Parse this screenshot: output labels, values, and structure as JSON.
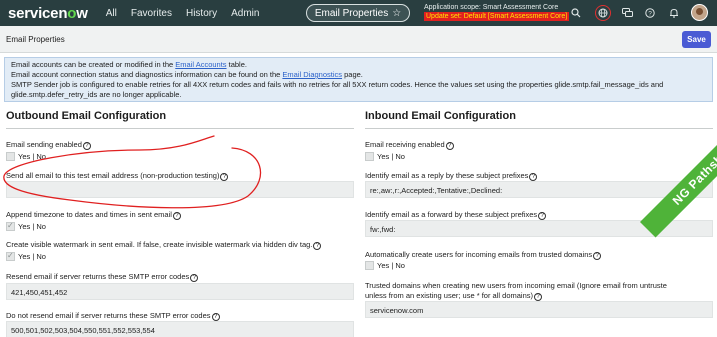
{
  "nav": {
    "brand_pre": "servicen",
    "brand_dot": "o",
    "brand_post": "w",
    "links": [
      "All",
      "Favorites",
      "History",
      "Admin"
    ],
    "pill_label": "Email Properties",
    "scope_line1": "Application scope: Smart Assessment Core",
    "scope_line2": "Update set: Default [Smart Assessment Core]",
    "icons": [
      "search-icon",
      "globe-icon",
      "chat-icon",
      "help-icon",
      "bell-icon",
      "avatar"
    ]
  },
  "form": {
    "title": "Email Properties",
    "save_label": "Save"
  },
  "info": {
    "line1_pre": "Email accounts can be created or modified in the ",
    "line1_link": "Email Accounts",
    "line1_post": " table.",
    "line2_pre": "Email account connection status and diagnostics information can be found on the ",
    "line2_link": "Email Diagnostics",
    "line2_post": " page.",
    "line3": "SMTP Sender job is configured to enable retries for all 4XX return codes and fails with no retries for all 5XX return codes. Hence the values set using the properties glide.smtp.fail_message_ids and",
    "line4": "glide.smtp.defer_retry_ids are no longer applicable."
  },
  "outbound": {
    "heading": "Outbound Email Configuration",
    "sending_label": "Email sending enabled",
    "sending_value": "Yes | No",
    "testaddr_label": "Send all email to this test email address (non-production testing)",
    "testaddr_value": "",
    "timezone_label": "Append timezone to dates and times in sent email",
    "timezone_value": "Yes | No",
    "watermark_label": "Create visible watermark in sent email. If false, create invisible watermark via hidden div tag.",
    "watermark_value": "Yes | No",
    "resend_label": "Resend email if server returns these SMTP error codes",
    "resend_value": "421,450,451,452",
    "noresend_label": "Do not resend email if server returns these SMTP error codes",
    "noresend_value": "500,501,502,503,504,550,551,552,553,554"
  },
  "inbound": {
    "heading": "Inbound Email Configuration",
    "receiving_label": "Email receiving enabled",
    "receiving_value": "Yes | No",
    "reply_label": "Identify email as a reply by these subject prefixes",
    "reply_value": "re:,aw:,r:,Accepted:,Tentative:,Declined:",
    "forward_label": "Identify email as a forward by these subject prefixes",
    "forward_value": "fw:,fwd:",
    "autocreate_label": "Automatically create users for incoming emails from trusted domains",
    "autocreate_value": "Yes | No",
    "trusted_label1": "Trusted domains when creating new users from incoming email (Ignore email from untruste",
    "trusted_label2": "unless from an existing user; use * for all domains)",
    "trusted_value": "servicenow.com"
  },
  "watermark": "NG Pathshala",
  "colors": {
    "nav_bg": "#293e40",
    "save_btn": "#4a5bd4",
    "info_bg": "#e2ecf6",
    "annotation": "#e02020",
    "ribbon": "#4fb339",
    "update_set_bg": "#e02020",
    "update_set_text": "#ffe600"
  }
}
